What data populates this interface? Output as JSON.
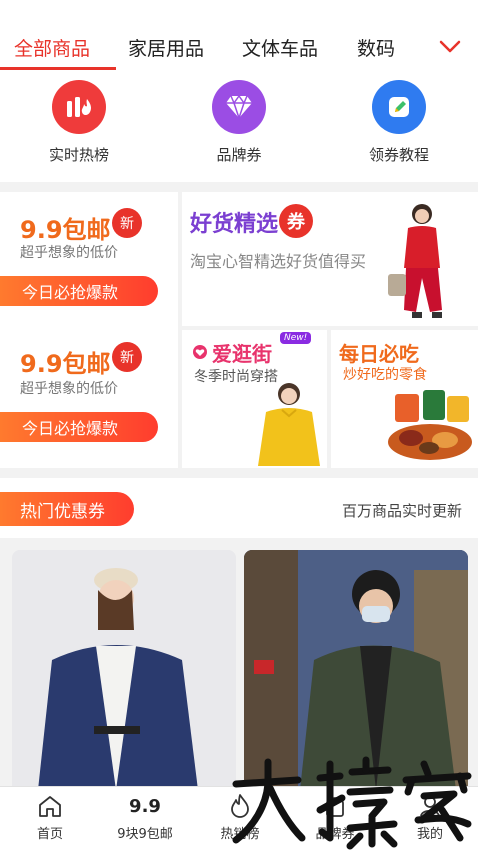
{
  "tabs": {
    "items": [
      {
        "label": "全部商品",
        "active": true
      },
      {
        "label": "家居用品",
        "active": false
      },
      {
        "label": "文体车品",
        "active": false
      },
      {
        "label": "数码",
        "active": false
      }
    ],
    "more_icon": "chevron-down-icon"
  },
  "quick_entries": [
    {
      "label": "实时热榜",
      "icon": "hot-list-icon",
      "color": "#ef3b3b"
    },
    {
      "label": "品牌券",
      "icon": "diamond-icon",
      "color": "#9b4de4"
    },
    {
      "label": "领券教程",
      "icon": "edit-note-icon",
      "color": "#2f7bf0"
    }
  ],
  "promo": {
    "deal_cards": [
      {
        "title": "9.9包邮",
        "badge": "新",
        "subtitle": "超乎想象的低价",
        "button": "今日必抢爆款"
      },
      {
        "title": "9.9包邮",
        "badge": "新",
        "subtitle": "超乎想象的低价",
        "button": "今日必抢爆款"
      }
    ],
    "good_picks": {
      "title": "好货精选",
      "badge": "券",
      "subtitle": "淘宝心智精选好货值得买"
    },
    "love_shop": {
      "title": "爱逛街",
      "tag": "New!",
      "subtitle": "冬季时尚穿搭"
    },
    "daily_eat": {
      "title": "每日必吃",
      "subtitle": "炒好吃的零食"
    }
  },
  "hot_coupons": {
    "title": "热门优惠券",
    "right_text": "百万商品实时更新"
  },
  "bottom_nav": [
    {
      "label": "首页",
      "icon": "home-icon"
    },
    {
      "label": "9块9包邮",
      "icon": "nine-nine-icon",
      "icon_text": "9.9"
    },
    {
      "label": "热销榜",
      "icon": "flame-icon"
    },
    {
      "label": "品牌券",
      "icon": "brand-bag-icon"
    },
    {
      "label": "我的",
      "icon": "profile-icon"
    }
  ],
  "colors": {
    "accent": "#e8332a",
    "orange": "#f06a1c",
    "purple": "#7b3fd1"
  }
}
